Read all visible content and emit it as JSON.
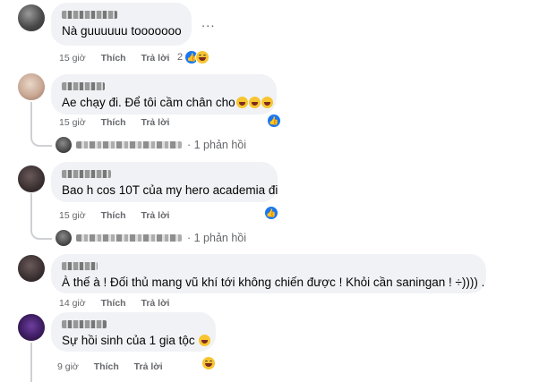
{
  "comments": [
    {
      "text": "Nà guuuuuu tooooooo",
      "meta": {
        "time": "15 giờ",
        "like": "Thích",
        "reply": "Trả lời"
      },
      "reaction_count": "2",
      "more": "..."
    },
    {
      "text": "Ae chạy đi. Để tôi cầm chân cho",
      "meta": {
        "time": "15 giờ",
        "like": "Thích",
        "reply": "Trả lời"
      },
      "replies": "· 1 phản hồi"
    },
    {
      "text": "Bao h cos 10T của my hero academia đi",
      "meta": {
        "time": "15 giờ",
        "like": "Thích",
        "reply": "Trả lời"
      },
      "replies": "· 1 phản hồi"
    },
    {
      "text": "À thế à ! Đối thủ mang vũ khí tới không chiến được ! Khỏi cần saningan ! ÷)))) .",
      "meta": {
        "time": "14 giờ",
        "like": "Thích",
        "reply": "Trả lời"
      }
    },
    {
      "text": "Sự hồi sinh của 1 gia tộc",
      "meta": {
        "time": "9 giờ",
        "like": "Thích",
        "reply": "Trả lời"
      }
    }
  ],
  "colors": {
    "bubble": "#f0f2f5",
    "meta": "#65676b",
    "like": "#1877f2",
    "haha": "#f7c530"
  },
  "icons": [
    "like-icon",
    "haha-icon",
    "more-options-icon"
  ]
}
